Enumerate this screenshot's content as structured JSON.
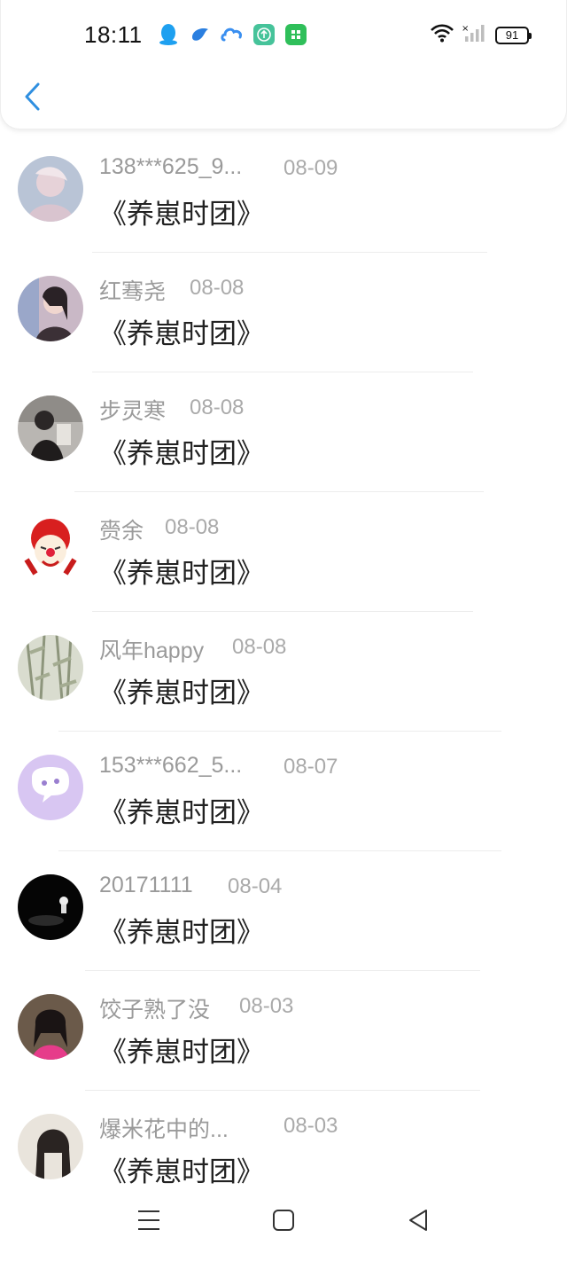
{
  "status_bar": {
    "time": "18:11",
    "notification_icons": [
      "qq-icon",
      "bird-app-icon",
      "cloud-app-icon",
      "upload-app-icon",
      "market-app-icon"
    ],
    "battery": "91"
  },
  "header": {
    "back_icon": "chevron-left-icon",
    "accent_color": "#2f8fe0"
  },
  "items": [
    {
      "name": "138***625_9...",
      "date": "08-09",
      "message": "《养崽时团》"
    },
    {
      "name": "红骞尧",
      "date": "08-08",
      "message": "《养崽时团》"
    },
    {
      "name": "步灵寒",
      "date": "08-08",
      "message": "《养崽时团》"
    },
    {
      "name": "赍余",
      "date": "08-08",
      "message": "《养崽时团》"
    },
    {
      "name": "风年happy",
      "date": "08-08",
      "message": "《养崽时团》"
    },
    {
      "name": "153***662_5...",
      "date": "08-07",
      "message": "《养崽时团》"
    },
    {
      "name": "20171111",
      "date": "08-04",
      "message": "《养崽时团》"
    },
    {
      "name": "饺子熟了没",
      "date": "08-03",
      "message": "《养崽时团》"
    },
    {
      "name": "爆米花中的...",
      "date": "08-03",
      "message": "《养崽时团》"
    }
  ],
  "nav_bar": {
    "icons": [
      "menu-icon",
      "home-square-icon",
      "back-triangle-icon"
    ]
  }
}
